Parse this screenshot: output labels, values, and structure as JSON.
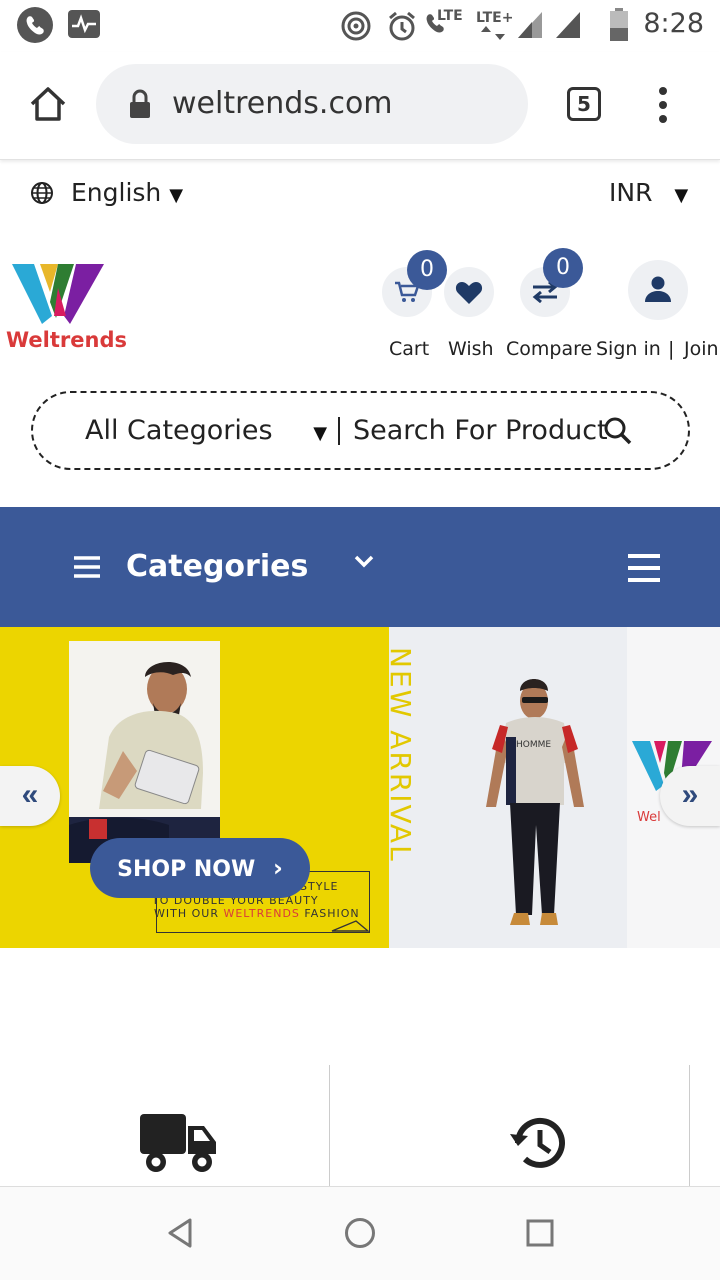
{
  "status_bar": {
    "time": "8:28",
    "lte1": "LTE",
    "lte2": "LTE+"
  },
  "browser": {
    "url": "weltrends.com",
    "tab_count": "5"
  },
  "top_bar": {
    "language": "English",
    "currency": "INR"
  },
  "header": {
    "brand": "Weltrends",
    "cart_label": "Cart",
    "cart_count": "0",
    "wish_label": "Wish",
    "compare_label": "Compare",
    "compare_count": "0",
    "signin_label": "Sign in",
    "separator": "|",
    "join_label": "Join"
  },
  "search": {
    "category": "All Categories",
    "placeholder": "Search For Product"
  },
  "nav": {
    "categories_label": "Categories"
  },
  "banner": {
    "shop_now": "SHOP NOW",
    "new_arrival": "NEW ARRIVAL",
    "tagline_line1": "STYLE",
    "tagline_line2": "TO DOUBLE YOUR BEAUTY",
    "tagline_line3_prefix": "WITH OUR ",
    "tagline_line3_brand": "WELTRENDS",
    "tagline_line3_suffix": " FASHION",
    "shirt_text": "HOMME",
    "logo_fragment": "Wel"
  },
  "colors": {
    "primary": "#3b5998",
    "banner_yellow": "#ecd500",
    "brand_red": "#d93a3a"
  }
}
